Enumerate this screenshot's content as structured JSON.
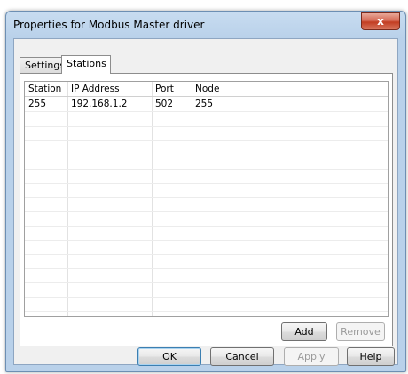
{
  "window": {
    "title": "Properties for Modbus Master driver",
    "close_glyph": "x"
  },
  "tabs": [
    {
      "label": "Settings",
      "active": false
    },
    {
      "label": "Stations",
      "active": true
    }
  ],
  "table": {
    "columns": [
      "Station",
      "IP Address",
      "Port",
      "Node"
    ],
    "rows": [
      [
        "255",
        "192.168.1.2",
        "502",
        "255"
      ]
    ]
  },
  "panel_buttons": {
    "add": "Add",
    "remove": "Remove"
  },
  "dialog_buttons": {
    "ok": "OK",
    "cancel": "Cancel",
    "apply": "Apply",
    "help": "Help"
  },
  "icons": {
    "close": "close-icon"
  },
  "colors": {
    "frame": "#b9d1ea",
    "client": "#f0f0f0",
    "close_button": "#c23d22"
  }
}
